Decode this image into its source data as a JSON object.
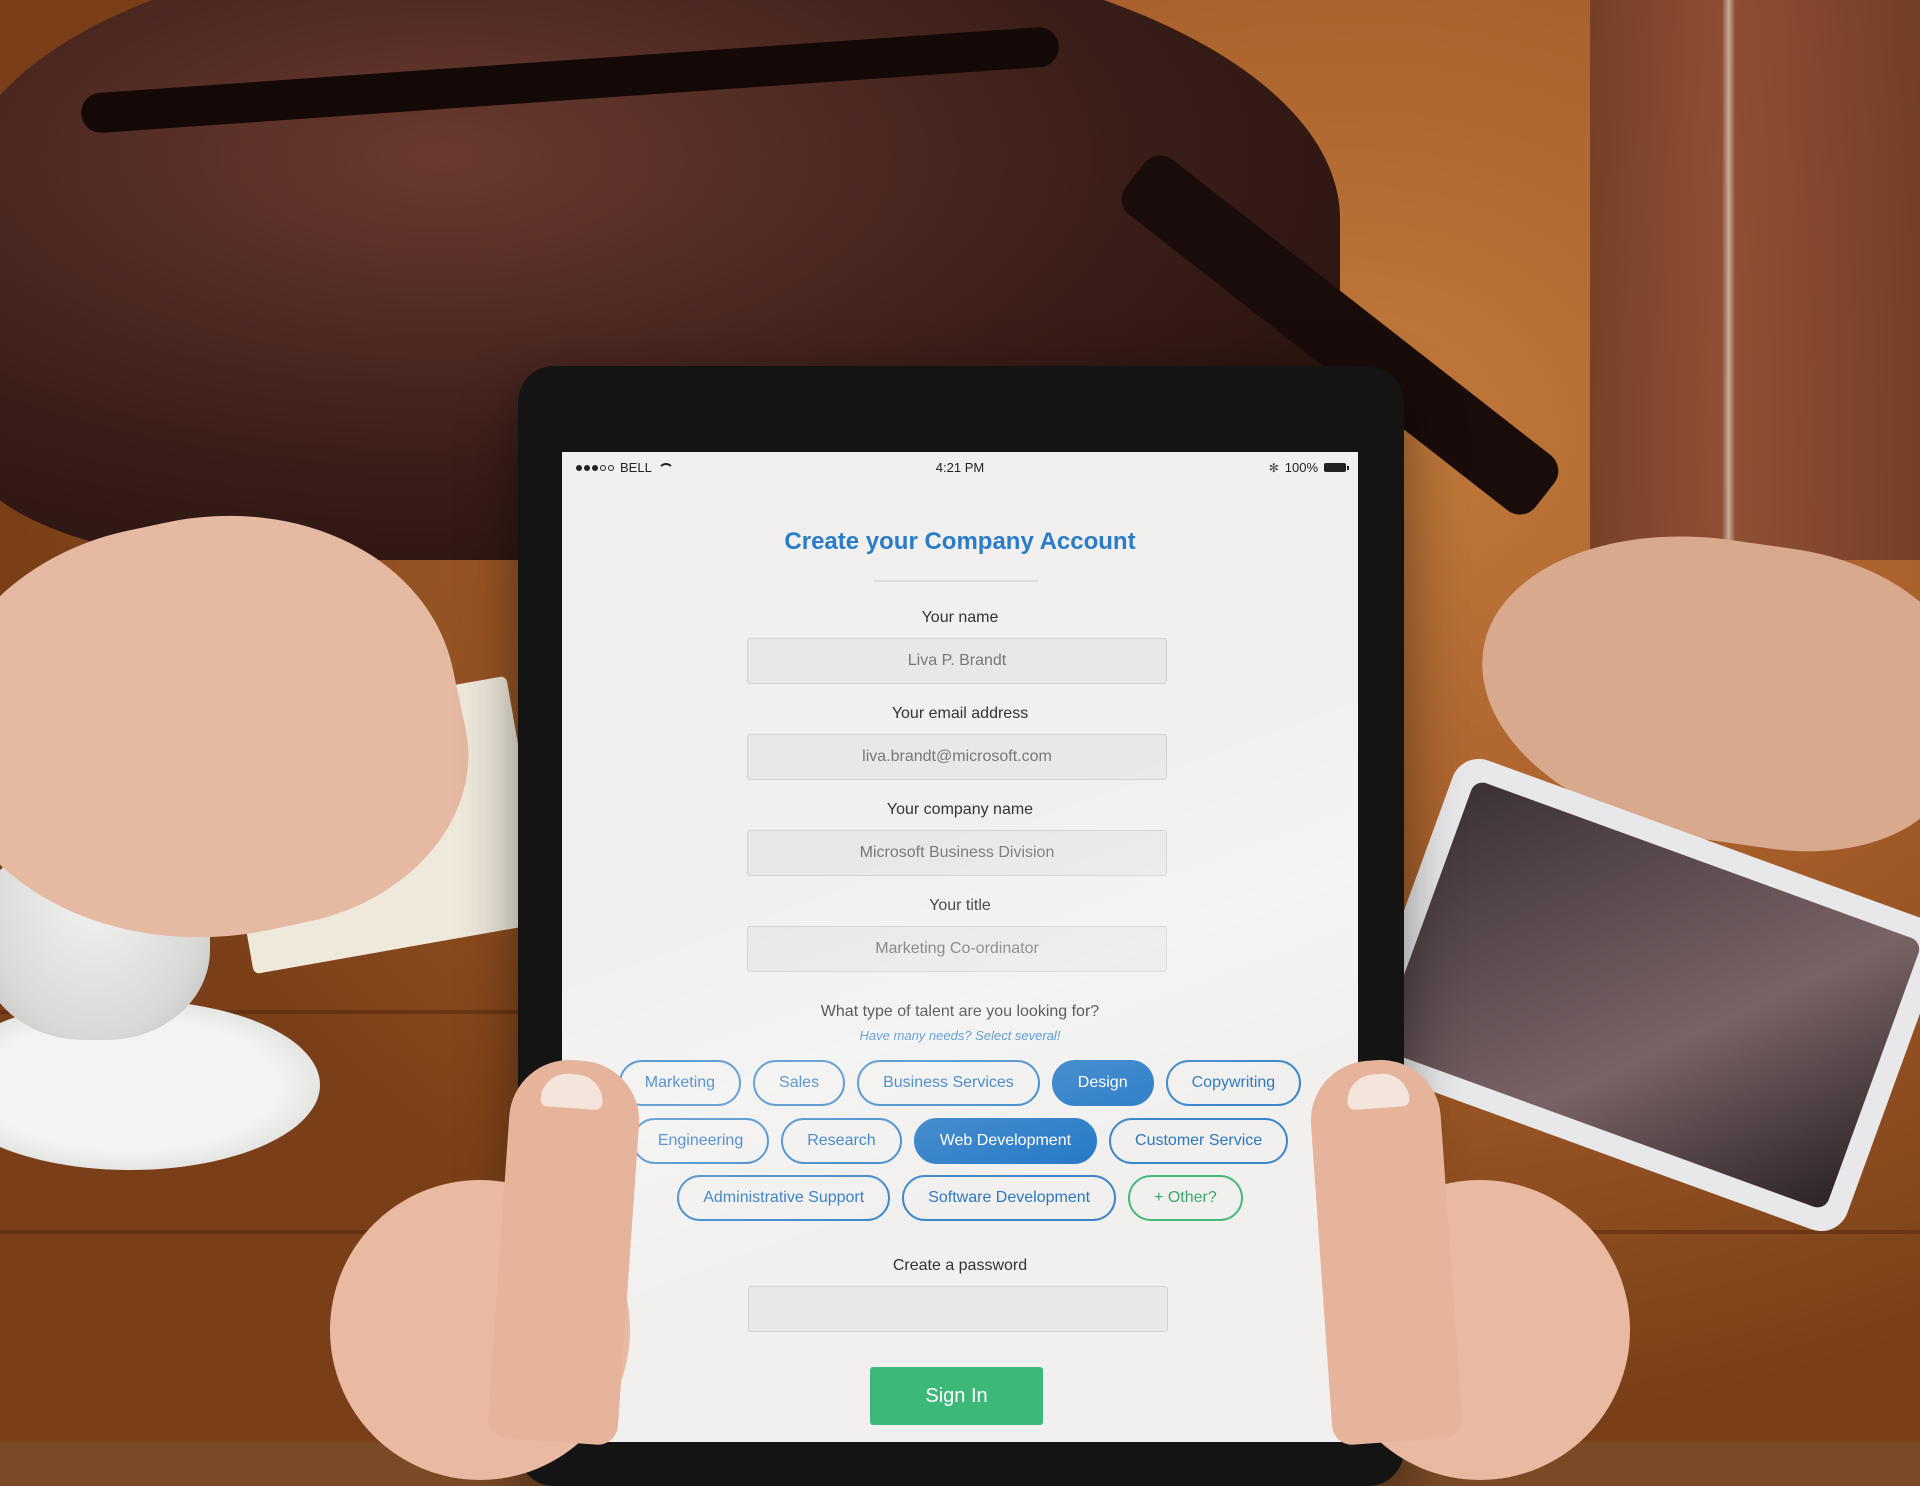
{
  "status_bar": {
    "carrier": "BELL",
    "time": "4:21 PM",
    "battery": "100%"
  },
  "form": {
    "title": "Create your Company Account",
    "name": {
      "label": "Your name",
      "value": "Liva P. Brandt"
    },
    "email": {
      "label": "Your email address",
      "value": "liva.brandt@microsoft.com"
    },
    "company": {
      "label": "Your company name",
      "value": "Microsoft Business Division"
    },
    "job_title": {
      "label": "Your title",
      "value": "Marketing Co-ordinator"
    },
    "talent": {
      "question": "What type of talent are you looking for?",
      "hint": "Have many needs? Select several!",
      "options": [
        {
          "label": "Marketing",
          "selected": false
        },
        {
          "label": "Sales",
          "selected": false
        },
        {
          "label": "Business Services",
          "selected": false
        },
        {
          "label": "Design",
          "selected": true
        },
        {
          "label": "Copywriting",
          "selected": false
        },
        {
          "label": "Engineering",
          "selected": false
        },
        {
          "label": "Research",
          "selected": false
        },
        {
          "label": "Web Development",
          "selected": true
        },
        {
          "label": "Customer Service",
          "selected": false
        },
        {
          "label": "Administrative Support",
          "selected": false
        },
        {
          "label": "Software Development",
          "selected": false
        }
      ],
      "other_label": "+ Other?"
    },
    "password": {
      "label": "Create a password",
      "value": ""
    },
    "submit_label": "Sign In"
  },
  "colors": {
    "accent": "#2a7cc7",
    "submit": "#3cb878",
    "other_chip": "#46b97b",
    "screen_bg": "#f1f0ef"
  }
}
